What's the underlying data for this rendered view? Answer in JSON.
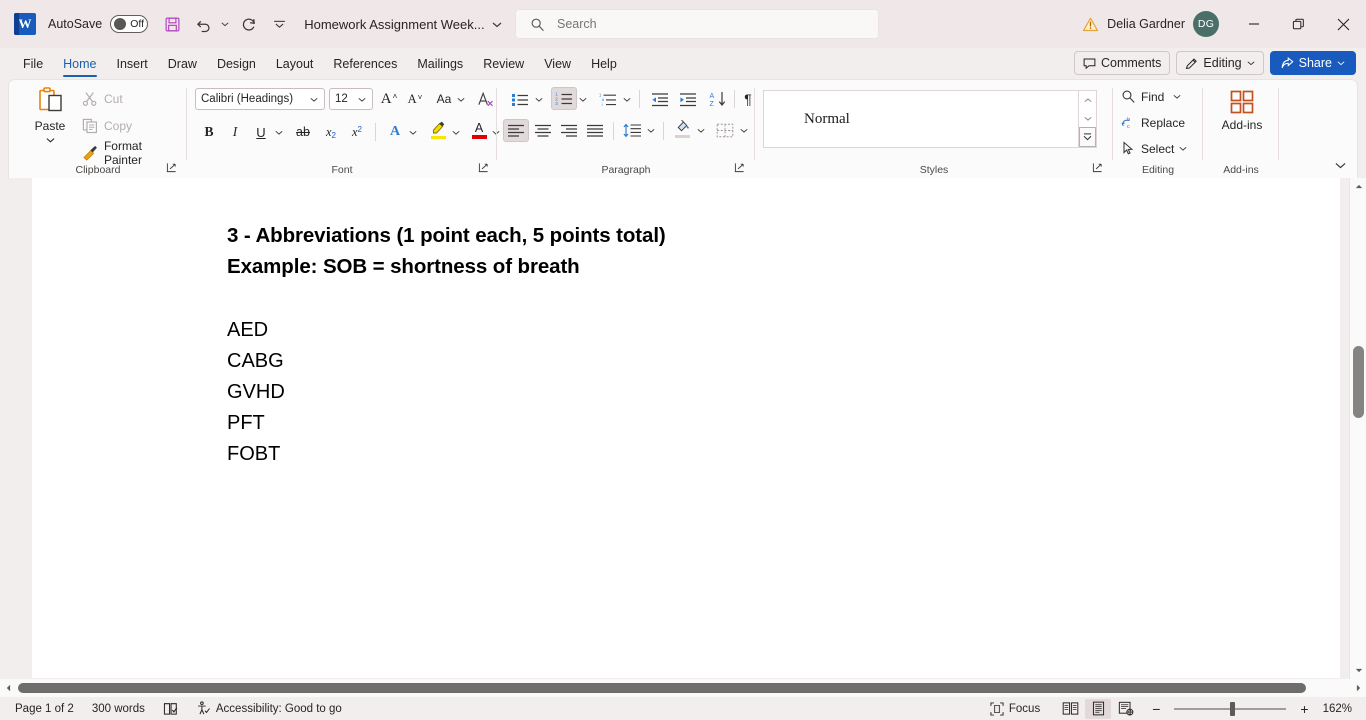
{
  "titlebar": {
    "app_logo": "word-logo",
    "autosave_label": "AutoSave",
    "autosave_state": "Off",
    "save_icon": "save-icon",
    "undo_icon": "undo-icon",
    "redo_icon": "redo-icon",
    "customize_qat_icon": "customize-quick-access-toolbar-icon",
    "document_title": "Homework Assignment Week...",
    "title_caret": "chevron-down-icon",
    "search_placeholder": "Search",
    "search_value": "",
    "warning_icon": "warning-icon",
    "user_name": "Delia Gardner",
    "user_initials": "DG",
    "minimize": "minimize-icon",
    "restore": "restore-icon",
    "close": "close-icon"
  },
  "tabs": [
    {
      "label": "File",
      "active": false
    },
    {
      "label": "Home",
      "active": true
    },
    {
      "label": "Insert",
      "active": false
    },
    {
      "label": "Draw",
      "active": false
    },
    {
      "label": "Design",
      "active": false
    },
    {
      "label": "Layout",
      "active": false
    },
    {
      "label": "References",
      "active": false
    },
    {
      "label": "Mailings",
      "active": false
    },
    {
      "label": "Review",
      "active": false
    },
    {
      "label": "View",
      "active": false
    },
    {
      "label": "Help",
      "active": false
    }
  ],
  "tabstrip_right": {
    "comments_label": "Comments",
    "editing_label": "Editing",
    "share_label": "Share"
  },
  "ribbon": {
    "clipboard": {
      "group_label": "Clipboard",
      "paste_label": "Paste",
      "cut_label": "Cut",
      "copy_label": "Copy",
      "format_painter_label": "Format Painter"
    },
    "font": {
      "group_label": "Font",
      "font_family_value": "Calibri (Headings)",
      "font_size_value": "12",
      "grow_font": "grow-font-icon",
      "shrink_font": "shrink-font-icon",
      "change_case": "Aa",
      "clear_formatting": "clear-formatting-icon",
      "bold": "B",
      "italic": "I",
      "underline": "U",
      "strikethrough": "ab",
      "subscript": "x",
      "superscript": "x",
      "text_effects": "A",
      "highlight": "A",
      "font_color": "A"
    },
    "paragraph": {
      "group_label": "Paragraph",
      "bullets": "bullets-icon",
      "numbering": "numbering-icon",
      "multilevel_list": "multilevel-list-icon",
      "decrease_indent": "decrease-indent-icon",
      "increase_indent": "increase-indent-icon",
      "sort": "sort-icon",
      "show_marks": "¶",
      "align_left": "align-left-icon",
      "align_center": "align-center-icon",
      "align_right": "align-right-icon",
      "justify": "justify-icon",
      "line_spacing": "line-spacing-icon",
      "shading": "shading-icon",
      "borders": "borders-icon"
    },
    "styles": {
      "group_label": "Styles",
      "selected_style": "Normal"
    },
    "editing": {
      "group_label": "Editing",
      "find_label": "Find",
      "replace_label": "Replace",
      "select_label": "Select"
    },
    "addins": {
      "group_label": "Add-ins",
      "button_label": "Add-ins"
    },
    "collapse_ribbon": "chevron-down-icon"
  },
  "document": {
    "heading_line1": "3 - Abbreviations (1 point each, 5 points total)",
    "heading_line2": "Example: SOB = shortness of breath",
    "items": [
      "AED",
      "CABG",
      "GVHD",
      "PFT",
      "FOBT"
    ]
  },
  "statusbar": {
    "page_label": "Page 1 of 2",
    "word_count": "300 words",
    "proofing_icon": "proofing-icon",
    "accessibility_label": "Accessibility: Good to go",
    "focus_label": "Focus",
    "read_mode_icon": "read-mode-icon",
    "print_layout_icon": "print-layout-icon",
    "web_layout_icon": "web-layout-icon",
    "zoom_out": "−",
    "zoom_in": "+",
    "zoom_level": "162%"
  },
  "colors": {
    "chrome": "#f0e8e8",
    "app_background": "#f3eeee",
    "accent_blue": "#185abd",
    "active_tab": "#1b5fb0",
    "avatar_bg": "#4a6f68",
    "addins_orange": "#c4521e",
    "paste_orange": "#e8820c"
  }
}
